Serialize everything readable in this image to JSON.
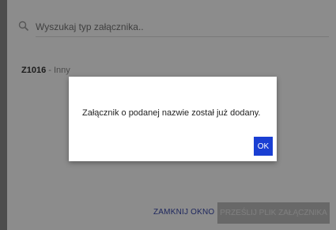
{
  "search": {
    "placeholder": "Wyszukaj typ załącznika.."
  },
  "item": {
    "code": "Z1016",
    "separator": " - ",
    "name": "Inny"
  },
  "dialog": {
    "message": "Załącznik o podanej nazwie został już dodany.",
    "ok_label": "OK"
  },
  "footer": {
    "close_label": "ZAMKNIJ OKNO",
    "send_label": "PRZEŚLIJ PLIK ZAŁĄCZNIKA"
  },
  "colors": {
    "accent": "#1a3fd3",
    "link": "#3949ab",
    "disabled": "#bdbdbd"
  }
}
